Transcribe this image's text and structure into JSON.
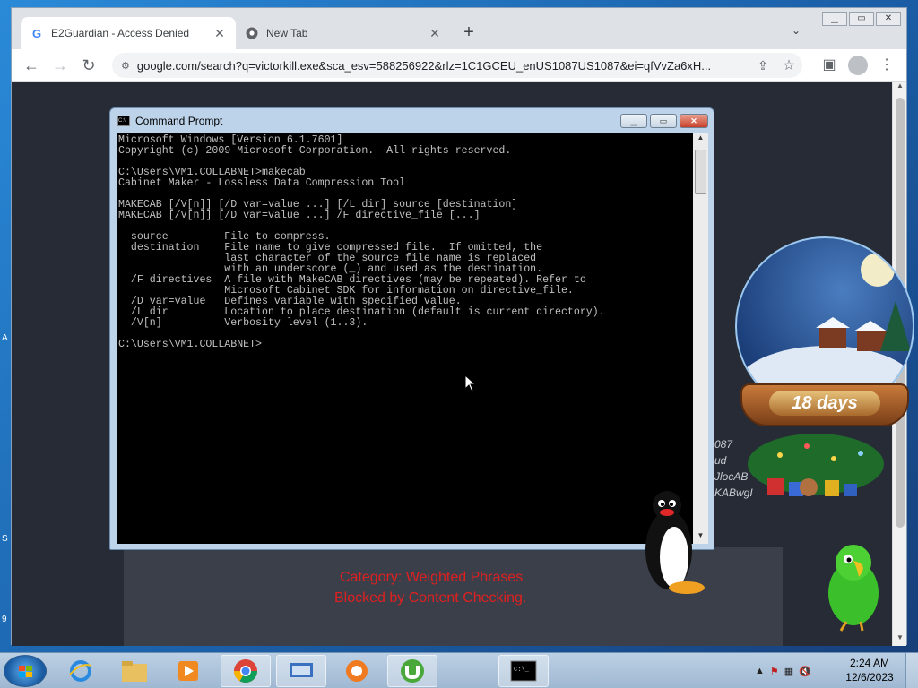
{
  "browser": {
    "tabs": [
      {
        "title": "E2Guardian - Access Denied",
        "favicon": "google-g-icon",
        "active": true
      },
      {
        "title": "New Tab",
        "favicon": "chrome-icon",
        "active": false
      }
    ],
    "new_tab_symbol": "+",
    "url": "google.com/search?q=victorkill.exe&sca_esv=588256922&rlz=1C1GCEU_enUS1087US1087&ei=qfVvZa6xH..."
  },
  "page": {
    "blocked_category": "Category: Weighted Phrases",
    "blocked_reason": "Blocked by Content Checking.",
    "background_text": [
      "087",
      "ud",
      "JlocAB",
      "KABwgI"
    ]
  },
  "cmd": {
    "title": "Command Prompt",
    "lines": [
      "Microsoft Windows [Version 6.1.7601]",
      "Copyright (c) 2009 Microsoft Corporation.  All rights reserved.",
      "",
      "C:\\Users\\VM1.COLLABNET>makecab",
      "Cabinet Maker - Lossless Data Compression Tool",
      "",
      "MAKECAB [/V[n]] [/D var=value ...] [/L dir] source [destination]",
      "MAKECAB [/V[n]] [/D var=value ...] /F directive_file [...]",
      "",
      "  source         File to compress.",
      "  destination    File name to give compressed file.  If omitted, the",
      "                 last character of the source file name is replaced",
      "                 with an underscore (_) and used as the destination.",
      "  /F directives  A file with MakeCAB directives (may be repeated). Refer to",
      "                 Microsoft Cabinet SDK for information on directive_file.",
      "  /D var=value   Defines variable with specified value.",
      "  /L dir         Location to place destination (default is current directory).",
      "  /V[n]          Verbosity level (1..3).",
      "",
      "C:\\Users\\VM1.COLLABNET>"
    ]
  },
  "widget": {
    "countdown": "18 days"
  },
  "taskbar": {
    "apps": [
      "internet-explorer-icon",
      "file-explorer-icon",
      "media-player-icon",
      "chrome-icon",
      "keyboard-app-icon",
      "avast-icon",
      "utorrent-icon",
      "cmd-icon"
    ],
    "time": "2:24 AM",
    "date": "12/6/2023"
  },
  "colors": {
    "blocked_text": "#e02020",
    "console_bg": "#000000",
    "console_text": "#c0c0c0",
    "page_bg": "#262b36"
  }
}
